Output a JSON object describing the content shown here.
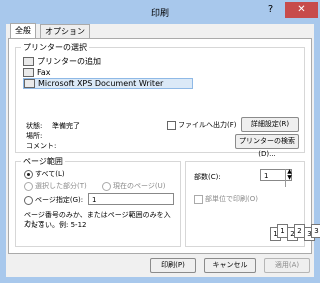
{
  "window": {
    "title": "印刷",
    "help_label": "?",
    "close_label": "✕"
  },
  "tabs": [
    "全般",
    "オプション"
  ],
  "printer_group": {
    "legend": "プリンターの選択",
    "items": [
      "プリンターの追加",
      "Fax",
      "Microsoft XPS Document Writer"
    ],
    "status_label": "状態:",
    "status_value": "準備完了",
    "location_label": "場所:",
    "comment_label": "コメント:",
    "print_to_file": "ファイルへ出力(F)",
    "advanced": "詳細設定(R)",
    "find_printer": "プリンターの検索(D)..."
  },
  "page_range": {
    "legend": "ページ範囲",
    "all": "すべて(L)",
    "selection": "選択した部分(T)",
    "current": "現在のページ(U)",
    "pages": "ページ指定(G):",
    "pages_value": "1",
    "hint_line1": "ページ番号のみか、またはページ範囲のみを入力して",
    "hint_line2": "ください。例: 5-12"
  },
  "copies": {
    "label": "部数(C):",
    "value": "1",
    "collate": "部単位で印刷(O)",
    "sheets": [
      "1",
      "1",
      "2",
      "2",
      "3",
      "3"
    ]
  },
  "footer": {
    "print": "印刷(P)",
    "cancel": "キャンセル",
    "apply": "適用(A)"
  }
}
